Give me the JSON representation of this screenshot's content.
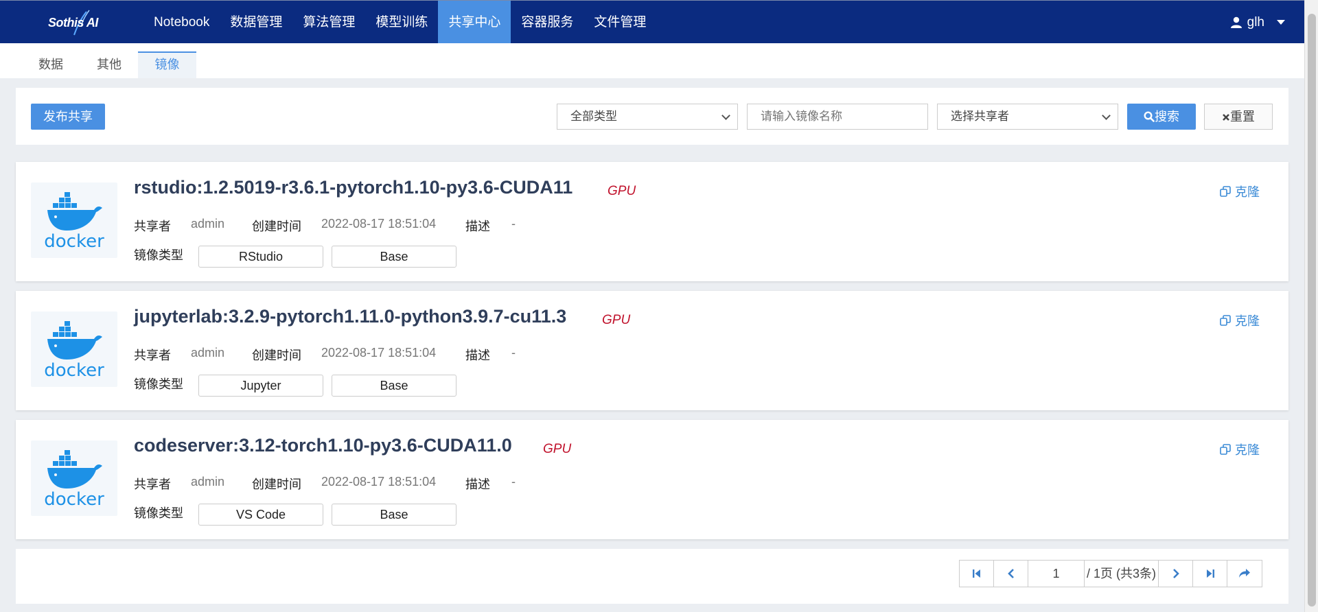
{
  "app": {
    "logo_text": "Sothis AI"
  },
  "nav": {
    "items": [
      {
        "label": "Notebook",
        "active": false
      },
      {
        "label": "数据管理",
        "active": false
      },
      {
        "label": "算法管理",
        "active": false
      },
      {
        "label": "模型训练",
        "active": false
      },
      {
        "label": "共享中心",
        "active": true
      },
      {
        "label": "容器服务",
        "active": false
      },
      {
        "label": "文件管理",
        "active": false
      }
    ],
    "user": "glh"
  },
  "subtabs": [
    {
      "label": "数据",
      "active": false
    },
    {
      "label": "其他",
      "active": false
    },
    {
      "label": "镜像",
      "active": true
    }
  ],
  "toolbar": {
    "publish_label": "发布共享",
    "type_select": "全部类型",
    "search_placeholder": "请输入镜像名称",
    "sharer_select": "选择共享者",
    "search_label": "搜索",
    "reset_label": "重置"
  },
  "labels": {
    "sharer": "共享者",
    "created": "创建时间",
    "desc": "描述",
    "image_type": "镜像类型",
    "clone": "克隆",
    "docker": "docker"
  },
  "images": [
    {
      "name": "rstudio:1.2.5019-r3.6.1-pytorch1.10-py3.6-CUDA11",
      "badge": "GPU",
      "sharer": "admin",
      "created": "2022-08-17 18:51:04",
      "desc": "-",
      "tags": [
        "RStudio",
        "Base"
      ]
    },
    {
      "name": "jupyterlab:3.2.9-pytorch1.11.0-python3.9.7-cu11.3",
      "badge": "GPU",
      "sharer": "admin",
      "created": "2022-08-17 18:51:04",
      "desc": "-",
      "tags": [
        "Jupyter",
        "Base"
      ]
    },
    {
      "name": "codeserver:3.12-torch1.10-py3.6-CUDA11.0",
      "badge": "GPU",
      "sharer": "admin",
      "created": "2022-08-17 18:51:04",
      "desc": "-",
      "tags": [
        "VS Code",
        "Base"
      ]
    }
  ],
  "pagination": {
    "current": "1",
    "info": "/ 1页  (共3条)"
  },
  "colors": {
    "nav_bg": "#0b2b80",
    "accent": "#4a90e2",
    "gpu": "#c0112b",
    "docker": "#1d91e6"
  }
}
